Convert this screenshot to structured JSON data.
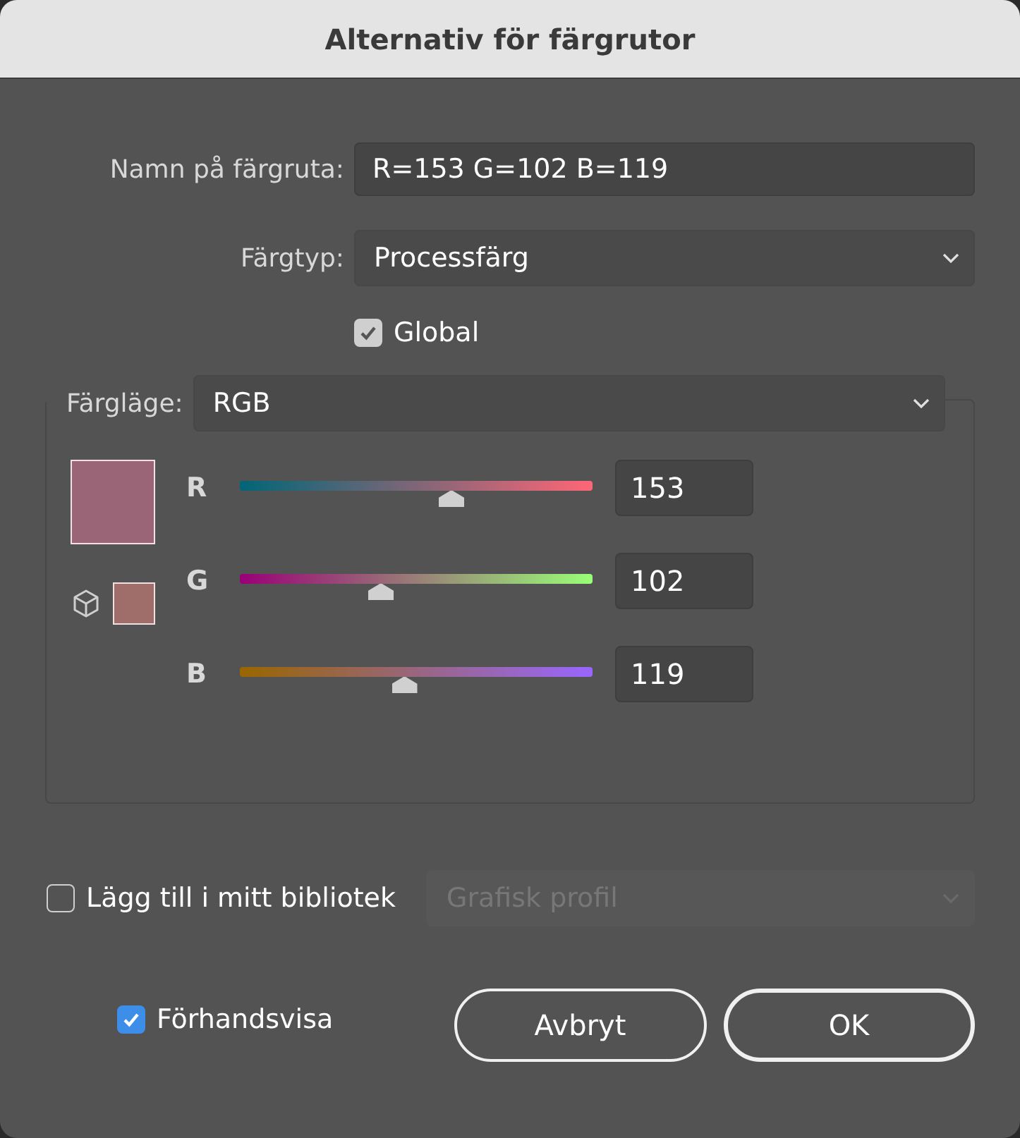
{
  "window": {
    "title": "Alternativ för färgrutor"
  },
  "name_field": {
    "label": "Namn på färgruta:",
    "value": "R=153 G=102 B=119"
  },
  "type_dropdown": {
    "label": "Färgtyp:",
    "value": "Processfärg"
  },
  "global": {
    "label": "Global",
    "checked": true,
    "disabled": true
  },
  "color_mode": {
    "label": "Färgläge:",
    "value": "RGB"
  },
  "swatches": [
    {
      "kind": "current",
      "color": "#9a6677"
    },
    {
      "kind": "gamut",
      "color": "#a06e6a"
    }
  ],
  "channels": [
    {
      "name": "R",
      "level": 0.6,
      "value": "153"
    },
    {
      "name": "G",
      "level": 0.4,
      "value": "102"
    },
    {
      "name": "B",
      "level": 0.467,
      "value": "119"
    }
  ],
  "library": {
    "label": "Lägg till i mitt bibliotek",
    "checked": false,
    "dropdown": {
      "value": "Grafisk profil",
      "disabled": true
    }
  },
  "preview": {
    "label": "Förhandsvisa",
    "checked": true,
    "disabled": false
  },
  "buttons": [
    {
      "label": "Avbryt",
      "default": false
    },
    {
      "label": "OK",
      "default": true
    }
  ]
}
